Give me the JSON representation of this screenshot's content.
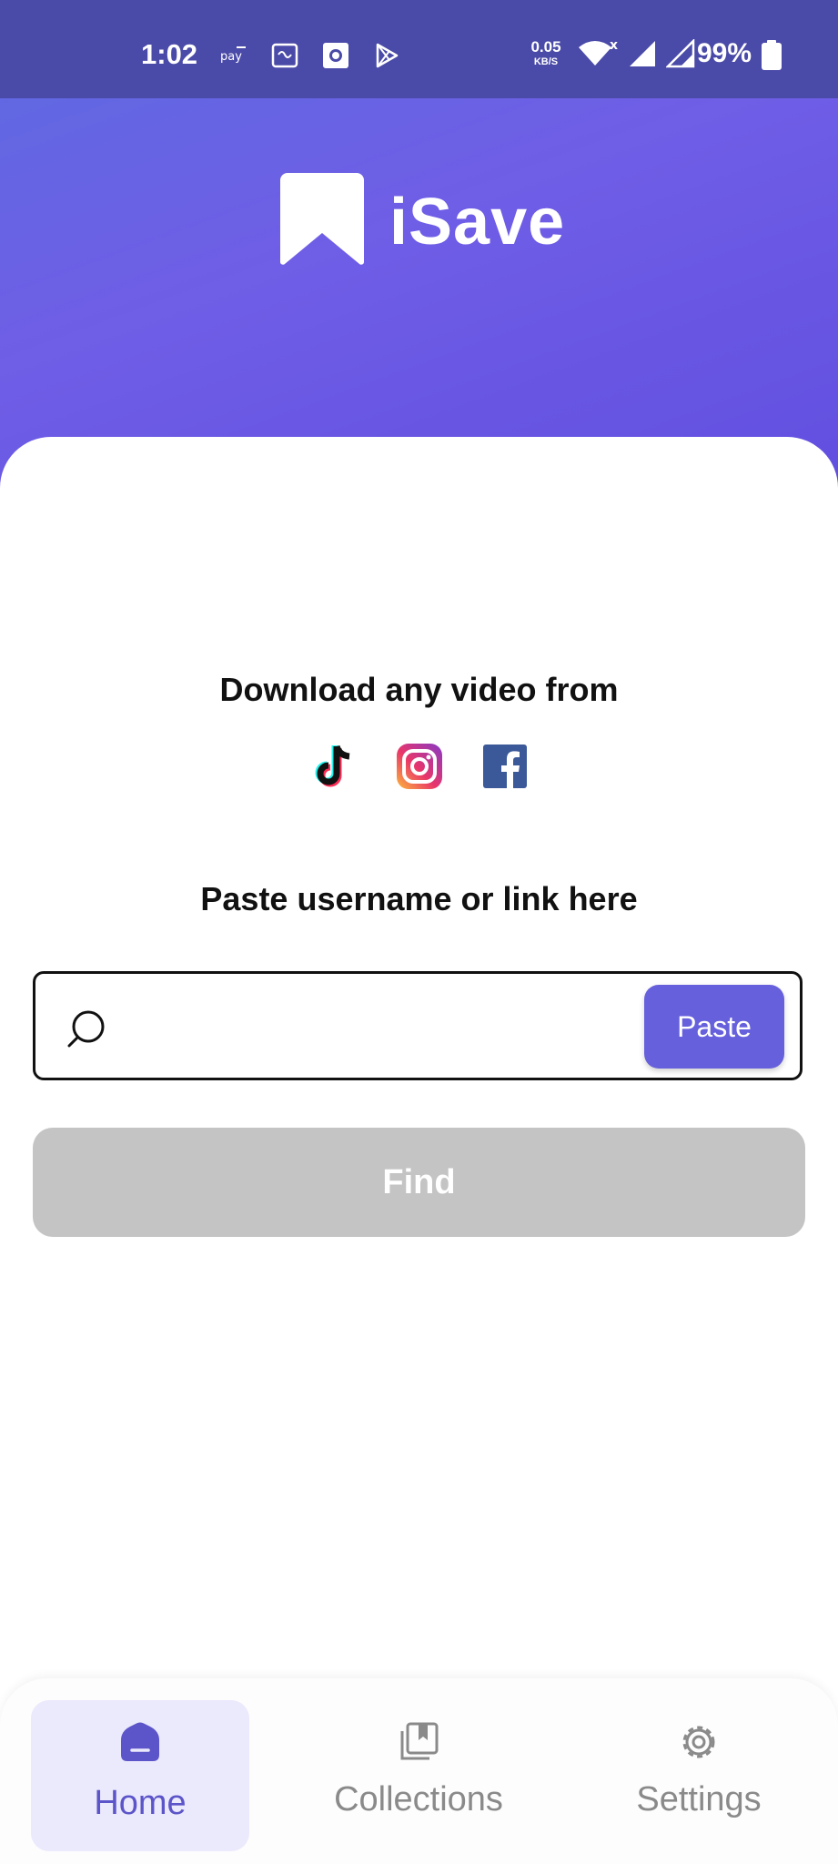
{
  "status_bar": {
    "time": "1:02",
    "net_speed": "0.05",
    "net_unit": "KB/S",
    "battery": "99%",
    "icons": [
      "airtel-pay-icon",
      "calendar-icon",
      "sun-icon",
      "play-store-icon",
      "wifi-icon",
      "signal-icon",
      "signal-icon",
      "battery-icon"
    ]
  },
  "header": {
    "app_name": "iSave",
    "brand_color": "#6b5fe4"
  },
  "main": {
    "heading": "Download any video from",
    "platforms": [
      "tiktok-icon",
      "instagram-icon",
      "facebook-icon"
    ],
    "paste_heading": "Paste username or link here",
    "search": {
      "value": "",
      "placeholder": ""
    },
    "paste_label": "Paste",
    "find_label": "Find"
  },
  "bottom_nav": {
    "items": [
      {
        "label": "Home",
        "icon": "home-icon",
        "active": true
      },
      {
        "label": "Collections",
        "icon": "collections-icon",
        "active": false
      },
      {
        "label": "Settings",
        "icon": "gear-icon",
        "active": false
      }
    ],
    "active_color": "#5c55c9",
    "inactive_color": "#8a8a8a"
  }
}
